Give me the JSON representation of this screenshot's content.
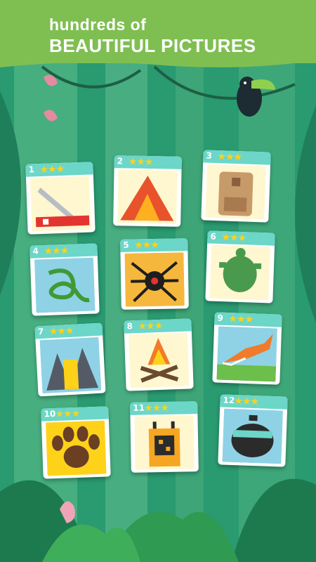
{
  "header": {
    "subtitle": "hundreds of",
    "title": "BEAUTIFUL PICTURES"
  },
  "colors": {
    "header_bg": "#7fbf52",
    "card_header": "#6cd6c8",
    "star": "#ffd21a"
  },
  "stars_glyph": "★★★",
  "puzzles": [
    {
      "number": "1",
      "icon": "pocket-knife-icon"
    },
    {
      "number": "2",
      "icon": "campfire-tent-icon"
    },
    {
      "number": "3",
      "icon": "backpack-icon"
    },
    {
      "number": "4",
      "icon": "snake-icon"
    },
    {
      "number": "5",
      "icon": "spider-icon"
    },
    {
      "number": "6",
      "icon": "turtle-icon"
    },
    {
      "number": "7",
      "icon": "mountain-icon"
    },
    {
      "number": "8",
      "icon": "campfire-icon"
    },
    {
      "number": "9",
      "icon": "fox-icon"
    },
    {
      "number": "10",
      "icon": "paw-print-icon"
    },
    {
      "number": "11",
      "icon": "walkie-talkie-icon"
    },
    {
      "number": "12",
      "icon": "pot-icon"
    }
  ]
}
